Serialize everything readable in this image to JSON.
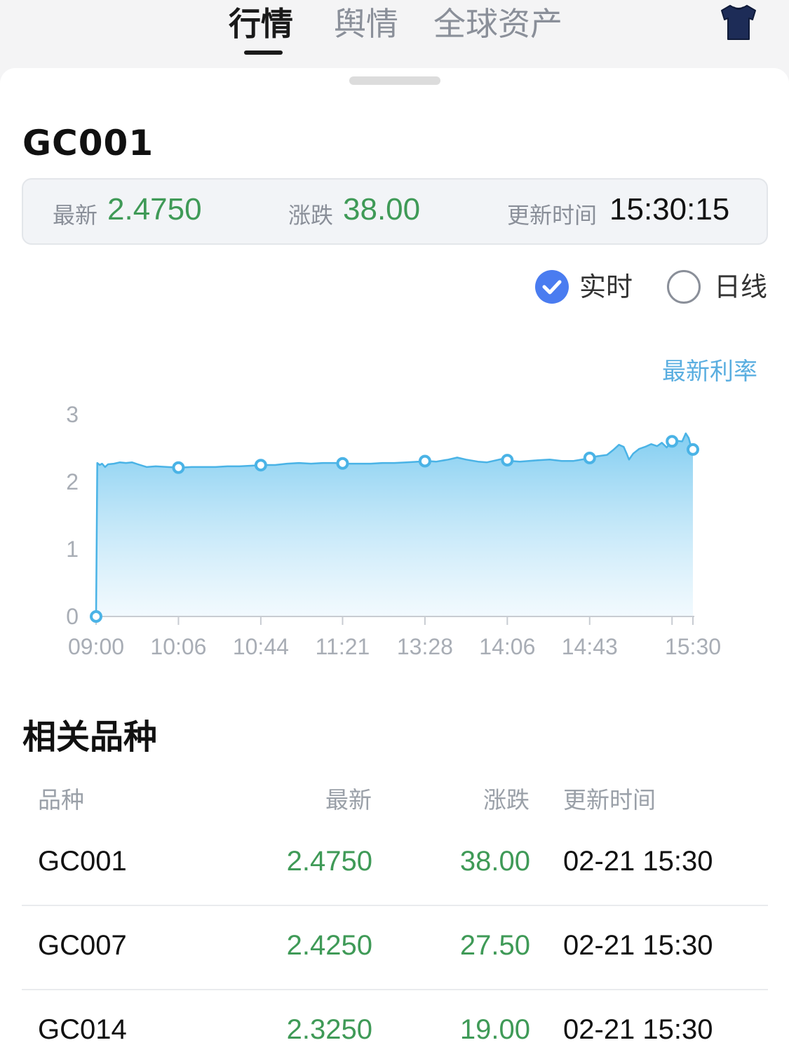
{
  "tabs": [
    {
      "label": "行情",
      "active": true
    },
    {
      "label": "舆情",
      "active": false
    },
    {
      "label": "全球资产",
      "active": false
    }
  ],
  "header_icon": "tshirt-icon",
  "colors": {
    "up_green": "#3f9a57",
    "accent_blue": "#4a7cf0",
    "chart_line": "#4ab3e6",
    "legend_text": "#5aaee0"
  },
  "instrument": {
    "code": "GC001",
    "latest_label": "最新",
    "latest_value": "2.4750",
    "change_label": "涨跌",
    "change_value": "38.00",
    "updated_label": "更新时间",
    "updated_value": "15:30:15"
  },
  "view_toggle": {
    "realtime_label": "实时",
    "realtime_checked": true,
    "daily_label": "日线",
    "daily_checked": false
  },
  "chart_data": {
    "type": "area",
    "title": "",
    "legend": [
      "最新利率"
    ],
    "legend_position": "top-right",
    "xlabel": "",
    "ylabel": "",
    "ylim": [
      0,
      3
    ],
    "y_ticks": [
      "0",
      "1",
      "2",
      "3"
    ],
    "x_ticks": [
      "09:00",
      "10:06",
      "10:44",
      "11:21",
      "13:28",
      "14:06",
      "14:43",
      "15:30"
    ],
    "grid": false,
    "series": [
      {
        "name": "最新利率",
        "points": [
          [
            0.0,
            0.0
          ],
          [
            0.002,
            2.28
          ],
          [
            0.006,
            2.25
          ],
          [
            0.01,
            2.27
          ],
          [
            0.015,
            2.22
          ],
          [
            0.02,
            2.26
          ],
          [
            0.03,
            2.27
          ],
          [
            0.04,
            2.29
          ],
          [
            0.05,
            2.28
          ],
          [
            0.06,
            2.29
          ],
          [
            0.07,
            2.26
          ],
          [
            0.085,
            2.22
          ],
          [
            0.1,
            2.23
          ],
          [
            0.12,
            2.22
          ],
          [
            0.14,
            2.21
          ],
          [
            0.16,
            2.22
          ],
          [
            0.18,
            2.22
          ],
          [
            0.2,
            2.22
          ],
          [
            0.22,
            2.23
          ],
          [
            0.24,
            2.23
          ],
          [
            0.26,
            2.24
          ],
          [
            0.28,
            2.25
          ],
          [
            0.3,
            2.25
          ],
          [
            0.32,
            2.27
          ],
          [
            0.34,
            2.28
          ],
          [
            0.36,
            2.27
          ],
          [
            0.38,
            2.28
          ],
          [
            0.4,
            2.28
          ],
          [
            0.42,
            2.27
          ],
          [
            0.44,
            2.27
          ],
          [
            0.46,
            2.27
          ],
          [
            0.48,
            2.28
          ],
          [
            0.5,
            2.28
          ],
          [
            0.52,
            2.29
          ],
          [
            0.54,
            2.3
          ],
          [
            0.555,
            2.31
          ],
          [
            0.57,
            2.3
          ],
          [
            0.59,
            2.33
          ],
          [
            0.605,
            2.36
          ],
          [
            0.62,
            2.33
          ],
          [
            0.64,
            2.3
          ],
          [
            0.655,
            2.29
          ],
          [
            0.67,
            2.32
          ],
          [
            0.68,
            2.34
          ],
          [
            0.695,
            2.31
          ],
          [
            0.71,
            2.3
          ],
          [
            0.725,
            2.31
          ],
          [
            0.74,
            2.32
          ],
          [
            0.76,
            2.33
          ],
          [
            0.78,
            2.31
          ],
          [
            0.8,
            2.31
          ],
          [
            0.82,
            2.34
          ],
          [
            0.84,
            2.38
          ],
          [
            0.856,
            2.4
          ],
          [
            0.866,
            2.47
          ],
          [
            0.876,
            2.55
          ],
          [
            0.884,
            2.52
          ],
          [
            0.889,
            2.42
          ],
          [
            0.893,
            2.33
          ],
          [
            0.9,
            2.42
          ],
          [
            0.91,
            2.49
          ],
          [
            0.92,
            2.52
          ],
          [
            0.93,
            2.56
          ],
          [
            0.94,
            2.53
          ],
          [
            0.948,
            2.58
          ],
          [
            0.956,
            2.51
          ],
          [
            0.964,
            2.6
          ],
          [
            0.972,
            2.61
          ],
          [
            0.982,
            2.6
          ],
          [
            0.988,
            2.72
          ],
          [
            0.993,
            2.65
          ],
          [
            0.996,
            2.55
          ],
          [
            1.0,
            2.48
          ]
        ],
        "markers_at_x": [
          0.0,
          0.138,
          0.276,
          0.413,
          0.551,
          0.689,
          0.827,
          0.965,
          1.0
        ]
      }
    ]
  },
  "related": {
    "title": "相关品种",
    "headers": [
      "品种",
      "最新",
      "涨跌",
      "更新时间"
    ],
    "rows": [
      [
        "GC001",
        "2.4750",
        "38.00",
        "02-21 15:30"
      ],
      [
        "GC007",
        "2.4250",
        "27.50",
        "02-21 15:30"
      ],
      [
        "GC014",
        "2.3250",
        "19.00",
        "02-21 15:30"
      ]
    ]
  }
}
